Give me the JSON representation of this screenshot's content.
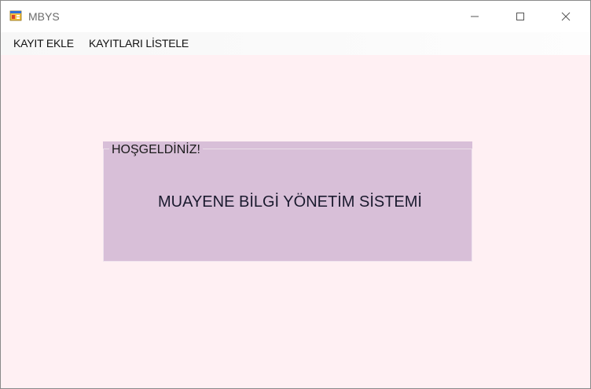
{
  "window": {
    "title": "MBYS"
  },
  "menu": {
    "items": [
      {
        "label": "KAYIT EKLE"
      },
      {
        "label": "KAYITLARI LİSTELE"
      }
    ]
  },
  "groupbox": {
    "caption": "HOŞGELDİNİZ!",
    "label": "MUAYENE BİLGİ YÖNETİM SİSTEMİ"
  },
  "colors": {
    "form_background": "#fff0f3",
    "groupbox_background": "#d8bfd8"
  },
  "icons": {
    "app": "windows-forms-app-icon",
    "minimize": "minimize-icon",
    "maximize": "maximize-icon",
    "close": "close-icon"
  }
}
